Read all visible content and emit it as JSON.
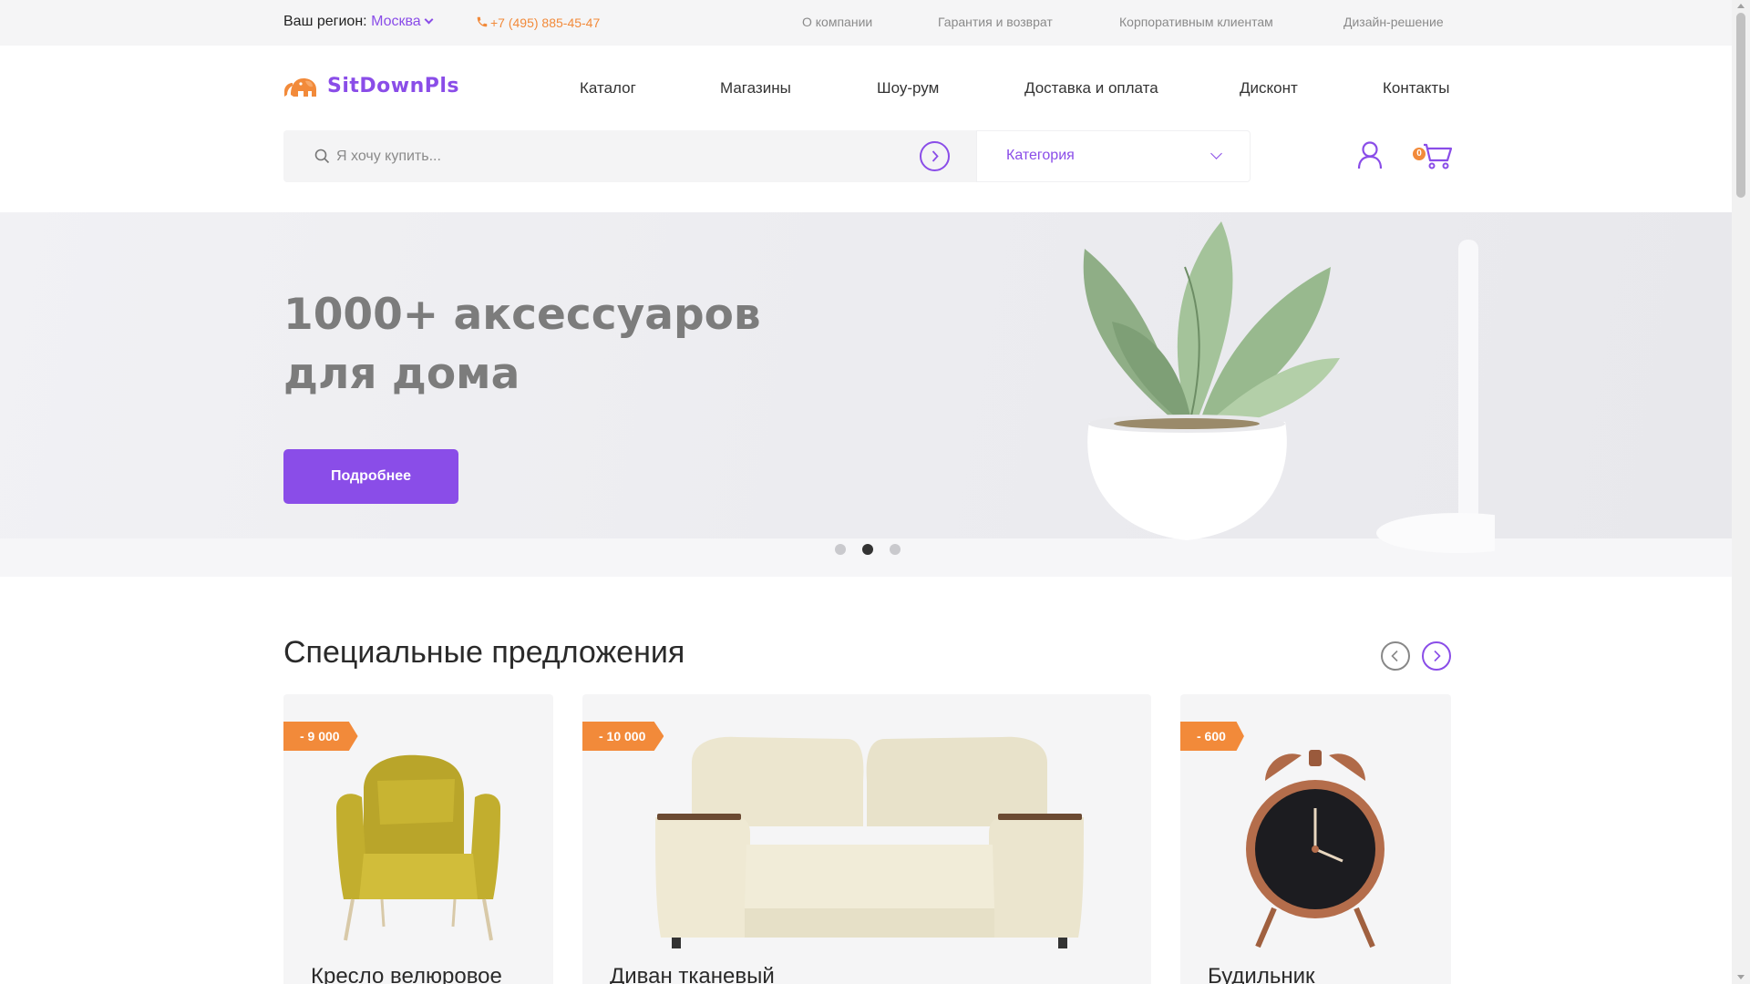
{
  "topbar": {
    "region_label": "Ваш регион:",
    "region_city": "Москва",
    "phone": "+7 (495) 885-45-47",
    "links": [
      "О компании",
      "Гарантия и возврат",
      "Корпоративным клиентам",
      "Дизайн-решение"
    ]
  },
  "header": {
    "logo_text": "SitDownPls",
    "nav": [
      "Каталог",
      "Магазины",
      "Шоу-рум",
      "Доставка и оплата",
      "Дисконт",
      "Контакты"
    ],
    "search_placeholder": "Я хочу купить...",
    "category_label": "Категория",
    "cart_count": "0"
  },
  "hero": {
    "title_line1": "1000+ аксессуаров",
    "title_line2": "для дома",
    "button_label": "Подробнее",
    "slides": 3,
    "active_slide": 2
  },
  "specials": {
    "title": "Специальные предложения",
    "cards": [
      {
        "discount": "- 9 000",
        "name": "Кресло велюровое",
        "image_icon": "armchair-icon"
      },
      {
        "discount": "- 10 000",
        "name": "Диван тканевый",
        "image_icon": "sofa-icon"
      },
      {
        "discount": "- 600",
        "name": "Будильник",
        "image_icon": "alarm-clock-icon"
      }
    ]
  },
  "colors": {
    "accent": "#8a4de8",
    "orange": "#f28a3a",
    "topbar_bg": "#f5f5f6"
  }
}
